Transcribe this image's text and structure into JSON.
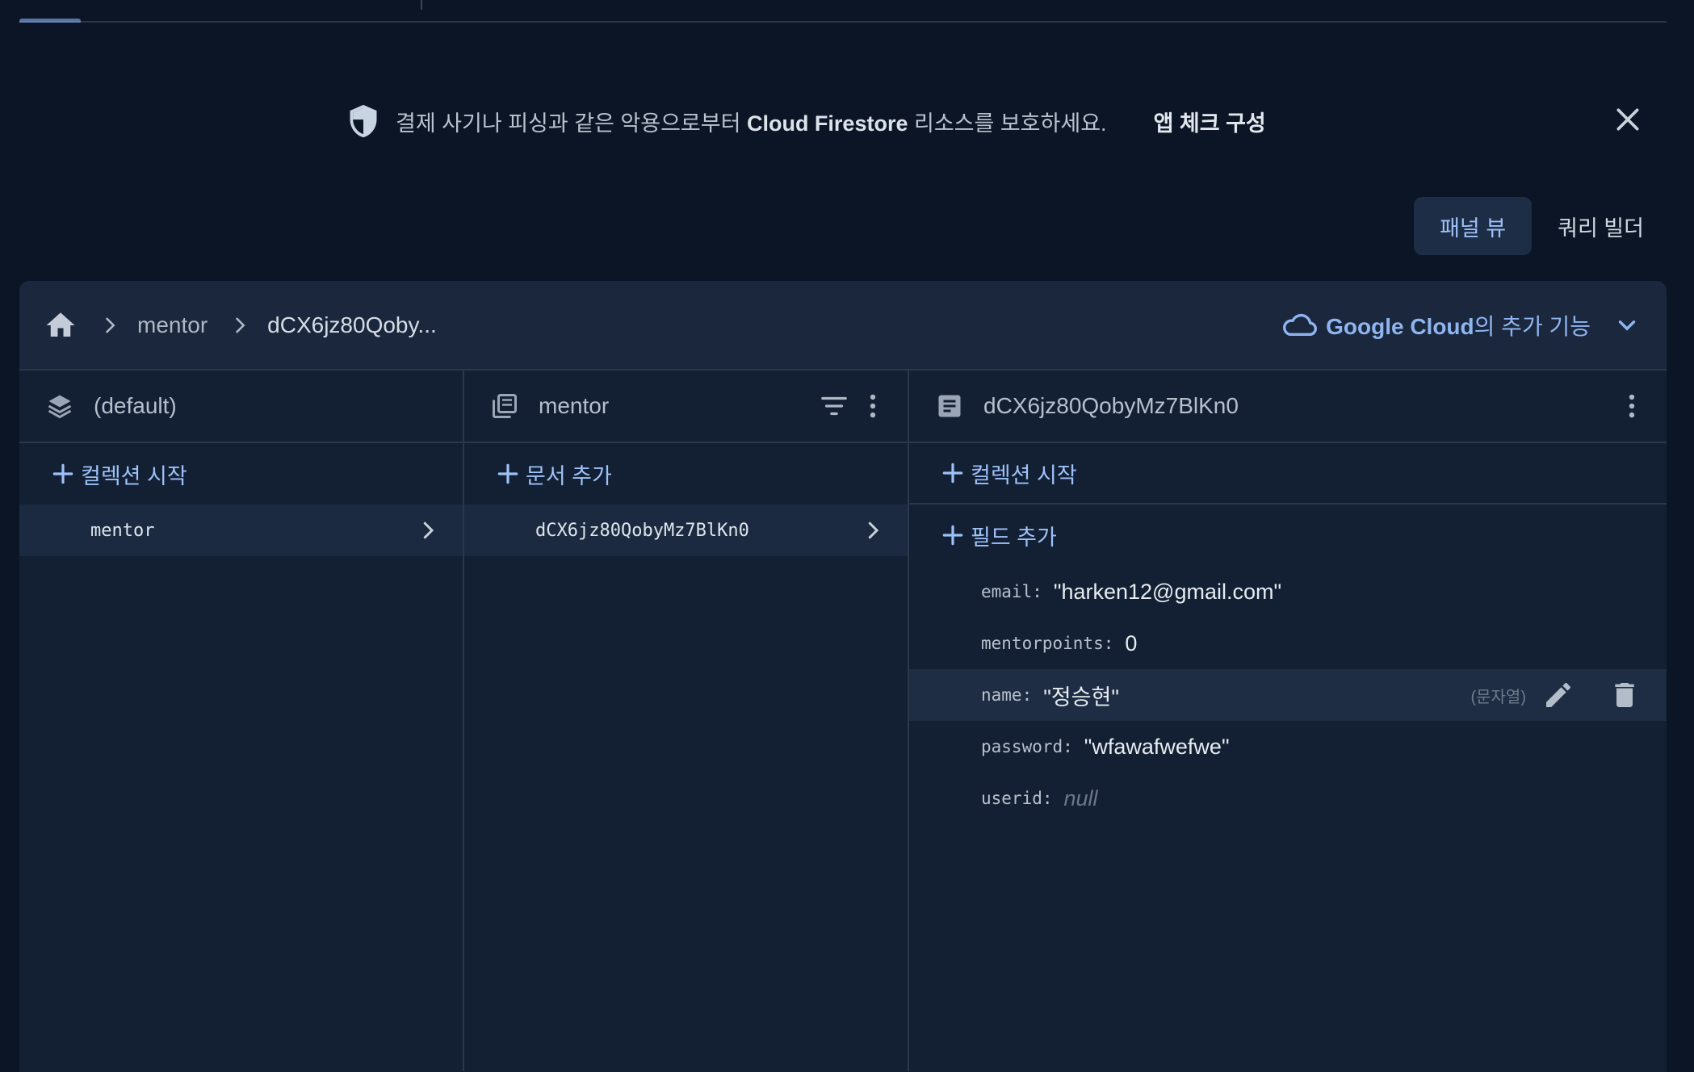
{
  "banner": {
    "text_before": "결제 사기나 피싱과 같은 악용으로부터 ",
    "text_strong": "Cloud Firestore",
    "text_after": " 리소스를 보호하세요.",
    "action": "앱 체크 구성"
  },
  "view_toggle": {
    "panel": "패널 뷰",
    "query": "쿼리 빌더"
  },
  "breadcrumb": {
    "items": [
      "mentor",
      "dCX6jz80Qoby..."
    ]
  },
  "google_cloud": {
    "strong": "Google Cloud",
    "rest": "의 추가 기능"
  },
  "col1": {
    "title": "(default)",
    "add": "컬렉션 시작",
    "items": [
      "mentor"
    ]
  },
  "col2": {
    "title": "mentor",
    "add": "문서 추가",
    "items": [
      "dCX6jz80QobyMz7BlKn0"
    ]
  },
  "col3": {
    "title": "dCX6jz80QobyMz7BlKn0",
    "add_collection": "컬렉션 시작",
    "add_field": "필드 추가",
    "fields": [
      {
        "key": "email:",
        "value": "\"harken12@gmail.com\""
      },
      {
        "key": "mentorpoints:",
        "value": "0"
      },
      {
        "key": "name:",
        "value": "\"정승현\"",
        "type": "(문자열)"
      },
      {
        "key": "password:",
        "value": "\"wfawafwefwe\""
      },
      {
        "key": "userid:",
        "value": "null"
      }
    ]
  },
  "colors": {
    "background": "#0b1525",
    "panel": "#132034",
    "accent": "#8ab4f8"
  }
}
